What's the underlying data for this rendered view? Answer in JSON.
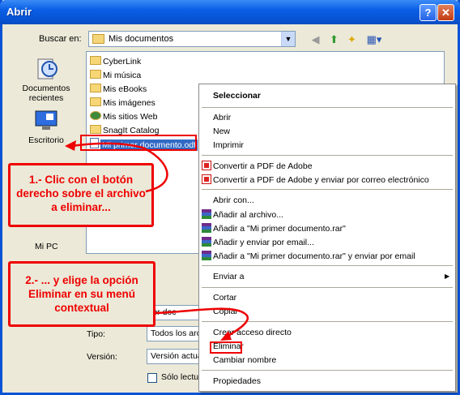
{
  "window": {
    "title": "Abrir",
    "help_glyph": "?",
    "close_glyph": "✕"
  },
  "lookin": {
    "label": "Buscar en:",
    "value": "Mis documentos"
  },
  "places": [
    {
      "label": "Documentos recientes",
      "icon": "recent-docs-icon"
    },
    {
      "label": "Escritorio",
      "icon": "desktop-icon"
    },
    {
      "label": "Mi PC",
      "icon": "my-computer-icon"
    }
  ],
  "files": [
    "CyberLink",
    "Mi música",
    "Mis eBooks",
    "Mis imágenes",
    "Mis sitios Web",
    "SnagIt Catalog",
    "Mi primer documento.odt"
  ],
  "form": {
    "filename_value": "ier doc",
    "type_label": "Tipo:",
    "type_value": "Todos los arc",
    "version_label": "Versión:",
    "version_value": "Versión actua",
    "readonly_label": "Sólo lectu"
  },
  "menu": {
    "items": [
      "Seleccionar",
      "Abrir",
      "New",
      "Imprimir",
      "Convertir a PDF de Adobe",
      "Convertir a PDF de Adobe y enviar por correo electrónico",
      "Abrir con...",
      "Añadir al archivo...",
      "Añadir a \"Mi primer documento.rar\"",
      "Añadir y enviar por email...",
      "Añadir a \"Mi primer documento.rar\" y enviar por email",
      "Enviar a",
      "Cortar",
      "Copiar",
      "Crear acceso directo",
      "Eliminar",
      "Cambiar nombre",
      "Propiedades"
    ]
  },
  "callouts": {
    "step1": "1.- Clic con el botón derecho sobre el archivo a eliminar...",
    "step2": "2.- ... y elige la opción Eliminar  en su menú contextual"
  },
  "colors": {
    "annotation": "#e00000",
    "titlebar": "#0a5fe6",
    "selection": "#316ac5"
  }
}
